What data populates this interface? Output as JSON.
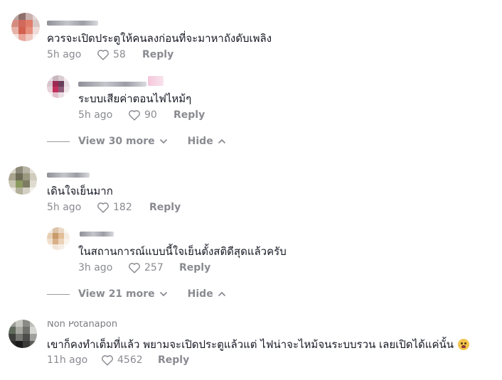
{
  "comments": [
    {
      "text": "ควรจะเปิดประตูให้คนลงก่อนที่จะมาหาถังดับเพลิง",
      "time": "5h ago",
      "likes": "58",
      "reply_label": "Reply",
      "reply": {
        "text": "ระบบเสียค่าตอนไฟไหม้ๆ",
        "time": "5h ago",
        "likes": "90",
        "reply_label": "Reply"
      },
      "view_more": "View 30 more",
      "hide": "Hide"
    },
    {
      "text": "เดินใจเย็นมาก",
      "time": "5h ago",
      "likes": "182",
      "reply_label": "Reply",
      "reply": {
        "text": "ในสถานการณ์แบบนี้ใจเย็นตั้งสติดีสุดแล้วครับ",
        "time": "3h ago",
        "likes": "257",
        "reply_label": "Reply"
      },
      "view_more": "View 21 more",
      "hide": "Hide"
    },
    {
      "username": "Non Potanapon",
      "text": "เขาก็คงทำเต็มที่แล้ว พยามจะเปิดประตูแล้วแต่ ไฟน่าจะไหม้จนระบบรวน เลยเปิดได้แค่นั้น",
      "time": "11h ago",
      "likes": "4562",
      "reply_label": "Reply"
    }
  ]
}
